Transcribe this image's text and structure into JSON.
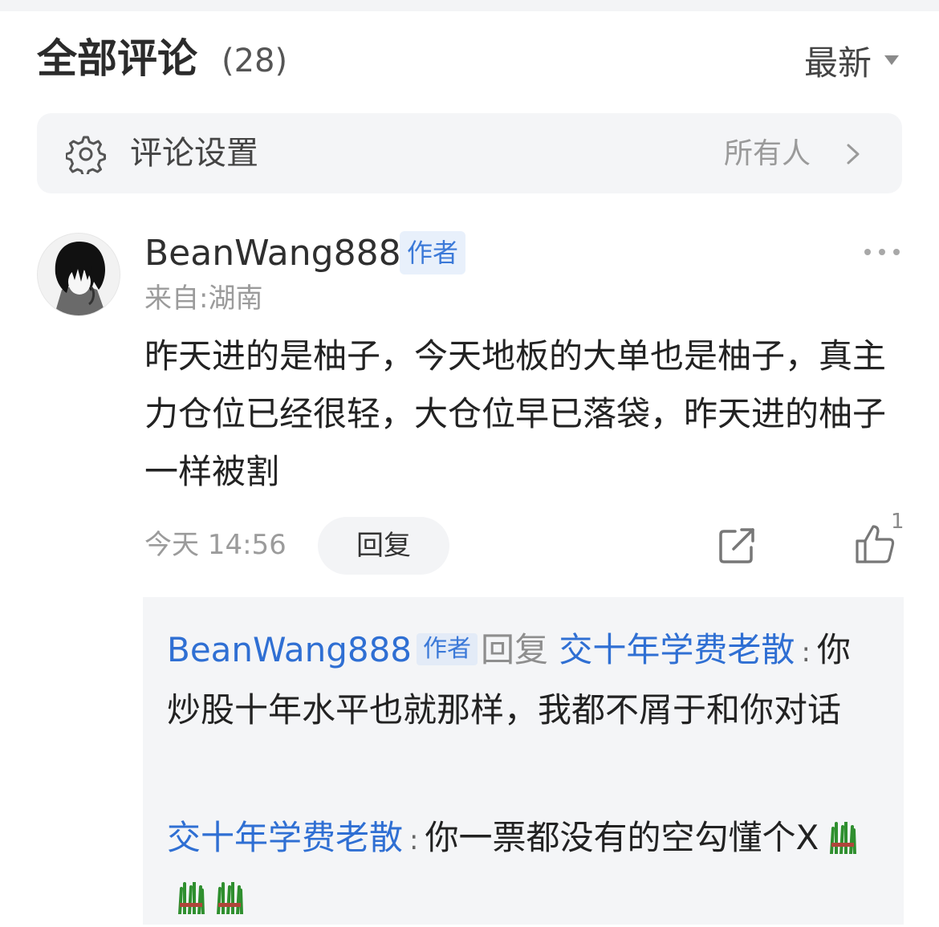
{
  "header": {
    "title": "全部评论",
    "count": "(28)",
    "sort_label": "最新"
  },
  "settings": {
    "label": "评论设置",
    "value": "所有人"
  },
  "comment": {
    "username": "BeanWang888",
    "badge": "作者",
    "location": "来自:湖南",
    "text": "昨天进的是柚子，今天地板的大单也是柚子，真主力仓位已经很轻，大仓位早已落袋，昨天进的柚子一样被割",
    "time": "今天 14:56",
    "reply_button": "回复",
    "like_count": "1"
  },
  "replies": [
    {
      "author": "BeanWang888",
      "badge": "作者",
      "reply_word": "回复",
      "target": "交十年学费老散",
      "colon": ":",
      "text": "你炒股十年水平也就那样，我都不屑于和你对话"
    },
    {
      "author": "交十年学费老散",
      "colon": ":",
      "text": "你一票都没有的空勾懂个X"
    }
  ],
  "icons": {
    "settings": "gear-icon",
    "chevron": "chevron-right-icon",
    "sort": "caret-down-icon",
    "more": "more-dots-icon",
    "share": "share-icon",
    "like": "thumbs-up-icon",
    "emoji": "grass-emoji-icon"
  },
  "colors": {
    "link": "#2f6fd3",
    "badge_bg": "#e8f0fb",
    "badge_text": "#3b79d8",
    "panel_bg": "#f4f5f7"
  }
}
